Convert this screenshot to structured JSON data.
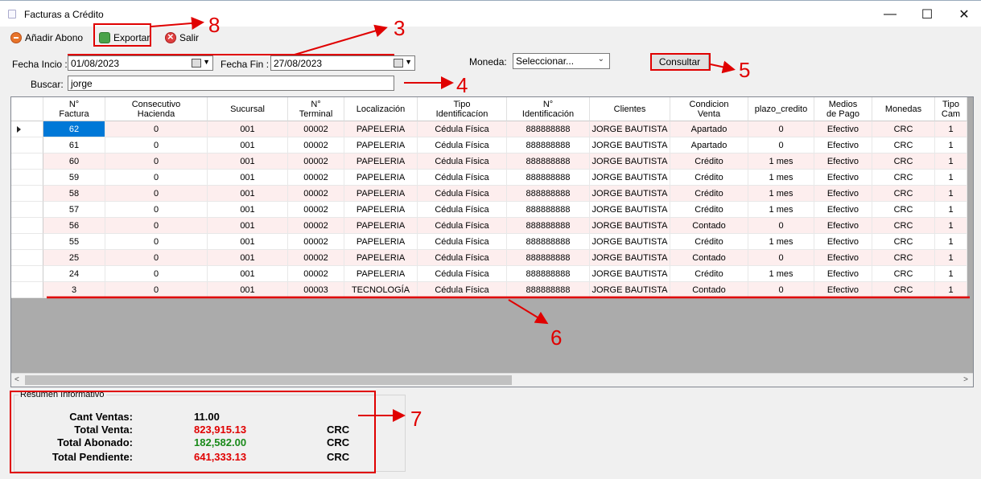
{
  "window": {
    "title": "Facturas a Crédito",
    "controls": {
      "minimize": "—",
      "maximize": "☐",
      "close": "✕"
    }
  },
  "toolbar": {
    "add_payment": "Añadir Abono",
    "export": "Exportar",
    "exit": "Salir"
  },
  "filters": {
    "start_label": "Fecha Incio :",
    "start_value": "01/08/2023",
    "end_label": "Fecha Fin :",
    "end_value": "27/08/2023",
    "currency_label": "Moneda:",
    "currency_value": "Seleccionar...",
    "search_label": "Buscar:",
    "search_value": "jorge",
    "consult_button": "Consultar"
  },
  "table": {
    "columns": [
      "N°\nFactura",
      "Consecutivo\nHacienda",
      "Sucursal",
      "N°\nTerminal",
      "Localización",
      "Tipo\nIdentificacíon",
      "N°\nIdentificación",
      "Clientes",
      "Condicion\nVenta",
      "plazo_credito",
      "Medios\nde Pago",
      "Monedas",
      "Tipo\nCam"
    ],
    "rows": [
      [
        "62",
        "0",
        "001",
        "00002",
        "PAPELERIA",
        "Cédula Física",
        "888888888",
        "JORGE BAUTISTA",
        "Apartado",
        "0",
        "Efectivo",
        "CRC",
        "1"
      ],
      [
        "61",
        "0",
        "001",
        "00002",
        "PAPELERIA",
        "Cédula Física",
        "888888888",
        "JORGE BAUTISTA",
        "Apartado",
        "0",
        "Efectivo",
        "CRC",
        "1"
      ],
      [
        "60",
        "0",
        "001",
        "00002",
        "PAPELERIA",
        "Cédula Física",
        "888888888",
        "JORGE BAUTISTA",
        "Crédito",
        "1 mes",
        "Efectivo",
        "CRC",
        "1"
      ],
      [
        "59",
        "0",
        "001",
        "00002",
        "PAPELERIA",
        "Cédula Física",
        "888888888",
        "JORGE BAUTISTA",
        "Crédito",
        "1 mes",
        "Efectivo",
        "CRC",
        "1"
      ],
      [
        "58",
        "0",
        "001",
        "00002",
        "PAPELERIA",
        "Cédula Física",
        "888888888",
        "JORGE BAUTISTA",
        "Crédito",
        "1 mes",
        "Efectivo",
        "CRC",
        "1"
      ],
      [
        "57",
        "0",
        "001",
        "00002",
        "PAPELERIA",
        "Cédula Física",
        "888888888",
        "JORGE BAUTISTA",
        "Crédito",
        "1 mes",
        "Efectivo",
        "CRC",
        "1"
      ],
      [
        "56",
        "0",
        "001",
        "00002",
        "PAPELERIA",
        "Cédula Física",
        "888888888",
        "JORGE BAUTISTA",
        "Contado",
        "0",
        "Efectivo",
        "CRC",
        "1"
      ],
      [
        "55",
        "0",
        "001",
        "00002",
        "PAPELERIA",
        "Cédula Física",
        "888888888",
        "JORGE BAUTISTA",
        "Crédito",
        "1 mes",
        "Efectivo",
        "CRC",
        "1"
      ],
      [
        "25",
        "0",
        "001",
        "00002",
        "PAPELERIA",
        "Cédula Física",
        "888888888",
        "JORGE BAUTISTA",
        "Contado",
        "0",
        "Efectivo",
        "CRC",
        "1"
      ],
      [
        "24",
        "0",
        "001",
        "00002",
        "PAPELERIA",
        "Cédula Física",
        "888888888",
        "JORGE BAUTISTA",
        "Crédito",
        "1 mes",
        "Efectivo",
        "CRC",
        "1"
      ],
      [
        "3",
        "0",
        "001",
        "00003",
        "TECNOLOGÍA",
        "Cédula Física",
        "888888888",
        "JORGE BAUTISTA",
        "Contado",
        "0",
        "Efectivo",
        "CRC",
        "1"
      ]
    ]
  },
  "summary": {
    "group_title": "Resumen Informativo",
    "sales_count_label": "Cant Ventas:",
    "sales_count_value": "11.00",
    "total_sale_label": "Total Venta:",
    "total_sale_value": "823,915.13",
    "total_paid_label": "Total Abonado:",
    "total_paid_value": "182,582.00",
    "total_pending_label": "Total Pendiente:",
    "total_pending_value": "641,333.13",
    "currency": "CRC",
    "colors": {
      "sale": "#e00000",
      "paid": "#1a8a1a",
      "pending": "#e00000"
    }
  },
  "annotations": {
    "color": "#e00000",
    "labels": [
      "8",
      "3",
      "4",
      "5",
      "6",
      "7"
    ]
  }
}
